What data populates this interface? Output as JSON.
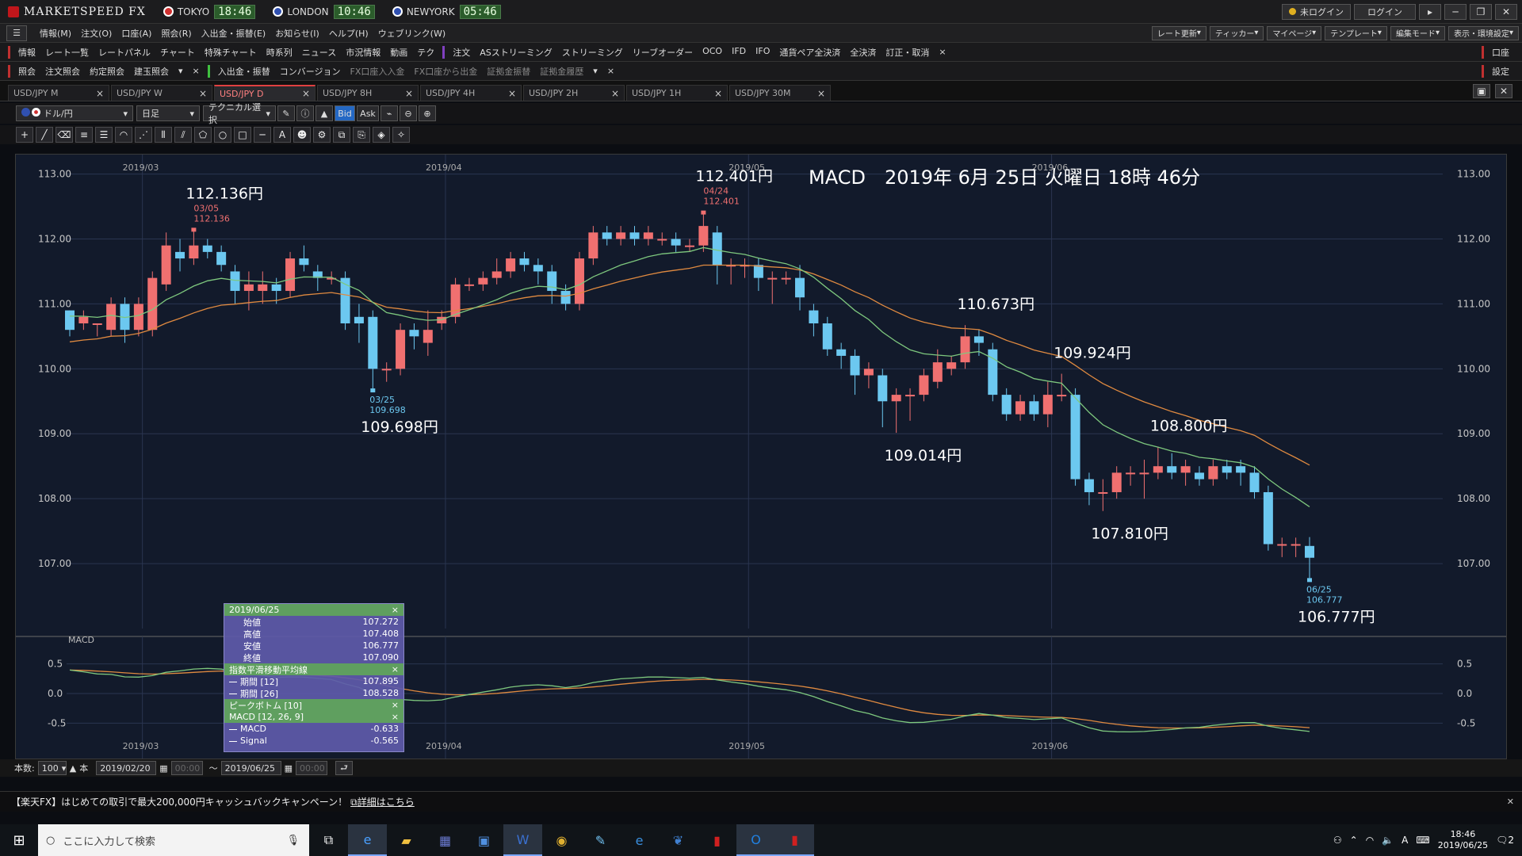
{
  "app": {
    "title": "MARKETSPEED FX"
  },
  "clocks": [
    {
      "city": "TOKYO",
      "time": "18:46",
      "color": "#d03030"
    },
    {
      "city": "LONDON",
      "time": "10:46",
      "color": "#3050b0"
    },
    {
      "city": "NEWYORK",
      "time": "05:46",
      "color": "#3050b0"
    }
  ],
  "titlebar": {
    "login_status": "未ログイン",
    "login_button": "ログイン"
  },
  "menu": [
    "情報(M)",
    "注文(O)",
    "口座(A)",
    "照会(R)",
    "入出金・振替(E)",
    "お知らせ(I)",
    "ヘルプ(H)",
    "ウェブリンク(W)"
  ],
  "menu_right": [
    "レート更新",
    "ティッカー",
    "マイページ",
    "テンプレート",
    "編集モード",
    "表示・環境設定"
  ],
  "toolbar1": {
    "info_label": "情報",
    "info_items": [
      "レート一覧",
      "レートパネル",
      "チャート",
      "特殊チャート",
      "時系列",
      "ニュース",
      "市況情報",
      "動画",
      "テク"
    ],
    "order_label": "注文",
    "order_items": [
      "ASストリーミング",
      "ストリーミング",
      "リーブオーダー",
      "OCO",
      "IFD",
      "IFO",
      "通貨ペア全決済",
      "全決済",
      "訂正・取消"
    ],
    "right": "口座"
  },
  "toolbar2": {
    "inquiry_label": "照会",
    "inquiry_items": [
      "注文照会",
      "約定照会",
      "建玉照会"
    ],
    "deposit_label": "入出金・振替",
    "deposit_items": [
      "コンバージョン",
      "FX口座入入金",
      "FX口座から出金",
      "証拠金振替",
      "証拠金履歴"
    ],
    "right": "設定"
  },
  "tabs": [
    {
      "label": "USD/JPY M",
      "active": false
    },
    {
      "label": "USD/JPY W",
      "active": false
    },
    {
      "label": "USD/JPY D",
      "active": true
    },
    {
      "label": "USD/JPY 8H",
      "active": false
    },
    {
      "label": "USD/JPY 4H",
      "active": false
    },
    {
      "label": "USD/JPY 2H",
      "active": false
    },
    {
      "label": "USD/JPY 1H",
      "active": false
    },
    {
      "label": "USD/JPY 30M",
      "active": false
    }
  ],
  "controls": {
    "pair": "ドル/円",
    "period": "日足",
    "technical": "テクニカル選択",
    "bid": "Bid",
    "ask": "Ask"
  },
  "chart_data": {
    "type": "candlestick",
    "title": "MACD　2019年 6月 25日 火曜日 18時 46分",
    "ylim": [
      106.0,
      113.3
    ],
    "yticks": [
      "113.00",
      "112.00",
      "111.00",
      "110.00",
      "109.00",
      "108.00",
      "107.00"
    ],
    "months": [
      "2019/03",
      "2019/04",
      "2019/05",
      "2019/06"
    ],
    "candles": [
      [
        110.9,
        110.6,
        110.9,
        110.5
      ],
      [
        110.7,
        110.8,
        110.9,
        110.6
      ],
      [
        110.7,
        110.7,
        110.7,
        110.5
      ],
      [
        110.6,
        111.0,
        111.1,
        110.5
      ],
      [
        111.0,
        110.6,
        111.1,
        110.4
      ],
      [
        110.6,
        111.0,
        111.1,
        110.5
      ],
      [
        110.6,
        111.4,
        111.5,
        110.5
      ],
      [
        111.3,
        111.9,
        112.1,
        111.2
      ],
      [
        111.8,
        111.7,
        112.0,
        111.5
      ],
      [
        111.7,
        111.9,
        112.136,
        111.6
      ],
      [
        111.9,
        111.8,
        112.0,
        111.7
      ],
      [
        111.8,
        111.6,
        111.9,
        111.5
      ],
      [
        111.5,
        111.2,
        111.6,
        111.0
      ],
      [
        111.2,
        111.3,
        111.5,
        110.9
      ],
      [
        111.2,
        111.3,
        111.5,
        111.0
      ],
      [
        111.3,
        111.2,
        111.4,
        111.0
      ],
      [
        111.2,
        111.7,
        111.8,
        111.1
      ],
      [
        111.7,
        111.6,
        111.9,
        111.5
      ],
      [
        111.5,
        111.4,
        111.6,
        111.2
      ],
      [
        111.4,
        111.4,
        111.5,
        111.3
      ],
      [
        111.4,
        110.7,
        111.5,
        110.6
      ],
      [
        110.8,
        110.7,
        111.0,
        110.4
      ],
      [
        110.8,
        110.0,
        110.9,
        109.698
      ],
      [
        110.0,
        110.0,
        110.1,
        109.8
      ],
      [
        110.0,
        110.6,
        110.7,
        109.9
      ],
      [
        110.6,
        110.5,
        110.7,
        110.3
      ],
      [
        110.4,
        110.6,
        110.9,
        110.2
      ],
      [
        110.7,
        110.8,
        110.9,
        110.6
      ],
      [
        110.8,
        111.3,
        111.4,
        110.7
      ],
      [
        111.3,
        111.3,
        111.4,
        111.2
      ],
      [
        111.3,
        111.4,
        111.5,
        111.2
      ],
      [
        111.4,
        111.5,
        111.7,
        111.3
      ],
      [
        111.5,
        111.7,
        111.8,
        111.4
      ],
      [
        111.7,
        111.6,
        111.8,
        111.5
      ],
      [
        111.6,
        111.5,
        111.7,
        111.3
      ],
      [
        111.5,
        111.2,
        111.6,
        111.0
      ],
      [
        111.2,
        111.0,
        111.3,
        110.9
      ],
      [
        111.0,
        111.7,
        111.8,
        110.9
      ],
      [
        111.7,
        112.1,
        112.2,
        111.6
      ],
      [
        112.1,
        112.0,
        112.2,
        111.9
      ],
      [
        112.0,
        112.1,
        112.2,
        111.9
      ],
      [
        112.1,
        112.0,
        112.2,
        111.9
      ],
      [
        112.0,
        112.1,
        112.2,
        111.9
      ],
      [
        112.0,
        112.0,
        112.1,
        111.9
      ],
      [
        112.0,
        111.9,
        112.1,
        111.8
      ],
      [
        111.9,
        111.9,
        112.0,
        111.8
      ],
      [
        111.9,
        112.2,
        112.401,
        111.8
      ],
      [
        112.1,
        111.6,
        112.2,
        111.3
      ],
      [
        111.6,
        111.6,
        111.7,
        111.3
      ],
      [
        111.6,
        111.6,
        111.7,
        111.4
      ],
      [
        111.6,
        111.4,
        111.7,
        111.2
      ],
      [
        111.4,
        111.4,
        111.5,
        111.0
      ],
      [
        111.4,
        111.4,
        111.5,
        111.3
      ],
      [
        111.4,
        111.1,
        111.6,
        110.9
      ],
      [
        110.9,
        110.7,
        111.0,
        110.5
      ],
      [
        110.7,
        110.3,
        110.8,
        110.2
      ],
      [
        110.3,
        110.2,
        110.4,
        110.0
      ],
      [
        110.2,
        109.9,
        110.3,
        109.6
      ],
      [
        109.9,
        110.0,
        110.1,
        109.7
      ],
      [
        109.9,
        109.5,
        110.0,
        109.1
      ],
      [
        109.5,
        109.6,
        109.7,
        109.014
      ],
      [
        109.6,
        109.6,
        109.7,
        109.2
      ],
      [
        109.6,
        109.9,
        110.0,
        109.5
      ],
      [
        109.8,
        110.1,
        110.3,
        109.7
      ],
      [
        110.0,
        110.1,
        110.2,
        109.9
      ],
      [
        110.1,
        110.5,
        110.673,
        110.0
      ],
      [
        110.5,
        110.4,
        110.6,
        110.2
      ],
      [
        110.3,
        109.6,
        110.4,
        109.5
      ],
      [
        109.6,
        109.3,
        109.7,
        109.2
      ],
      [
        109.3,
        109.5,
        109.6,
        109.2
      ],
      [
        109.5,
        109.3,
        109.6,
        109.2
      ],
      [
        109.3,
        109.6,
        109.8,
        109.1
      ],
      [
        109.6,
        109.6,
        109.924,
        109.5
      ],
      [
        109.6,
        108.3,
        109.7,
        108.2
      ],
      [
        108.3,
        108.1,
        108.4,
        107.9
      ],
      [
        108.1,
        108.1,
        108.3,
        107.81
      ],
      [
        108.1,
        108.4,
        108.5,
        108.0
      ],
      [
        108.4,
        108.4,
        108.5,
        108.2
      ],
      [
        108.4,
        108.4,
        108.6,
        108.0
      ],
      [
        108.4,
        108.5,
        108.8,
        108.3
      ],
      [
        108.5,
        108.4,
        108.7,
        108.3
      ],
      [
        108.4,
        108.5,
        108.6,
        108.2
      ],
      [
        108.4,
        108.3,
        108.5,
        108.2
      ],
      [
        108.3,
        108.5,
        108.6,
        108.2
      ],
      [
        108.5,
        108.4,
        108.6,
        108.3
      ],
      [
        108.5,
        108.4,
        108.6,
        108.2
      ],
      [
        108.4,
        108.1,
        108.5,
        108.0
      ],
      [
        108.1,
        107.3,
        108.2,
        107.2
      ],
      [
        107.3,
        107.3,
        107.4,
        107.1
      ],
      [
        107.3,
        107.3,
        107.4,
        107.1
      ],
      [
        107.272,
        107.09,
        107.408,
        106.777
      ]
    ],
    "peak_labels": [
      {
        "text": "112.136円",
        "sub_date": "03/05",
        "sub_val": "112.136",
        "type": "high",
        "idx": 9
      },
      {
        "text": "109.698円",
        "sub_date": "03/25",
        "sub_val": "109.698",
        "type": "low",
        "idx": 22
      },
      {
        "text": "112.401円",
        "sub_date": "04/24",
        "sub_val": "112.401",
        "type": "high",
        "idx": 46
      },
      {
        "text": "109.014円",
        "type": "low",
        "idx": 60
      },
      {
        "text": "110.673円",
        "type": "high",
        "idx": 65
      },
      {
        "text": "109.924円",
        "type": "high",
        "idx": 72
      },
      {
        "text": "107.810円",
        "type": "low",
        "idx": 75
      },
      {
        "text": "108.800円",
        "type": "high",
        "idx": 79
      },
      {
        "text": "106.777円",
        "sub_date": "06/25",
        "sub_val": "106.777",
        "type": "low",
        "idx": 90
      }
    ],
    "ema12_color": "#7ec87e",
    "ema26_color": "#e08a40",
    "up_color": "#f07070",
    "down_color": "#6cc8f0",
    "macd": {
      "label": "MACD",
      "ylim": [
        -0.75,
        0.75
      ],
      "yticks": [
        "0.5",
        "0.0",
        "-0.5"
      ],
      "macd_color": "#7ec87e",
      "signal_color": "#e08a40"
    }
  },
  "infobox": {
    "date": "2019/06/25",
    "ohlc": [
      {
        "label": "始値",
        "value": "107.272"
      },
      {
        "label": "高値",
        "value": "107.408"
      },
      {
        "label": "安値",
        "value": "106.777"
      },
      {
        "label": "終値",
        "value": "107.090"
      }
    ],
    "ema_title": "指数平滑移動平均線",
    "ema": [
      {
        "label": "期間 [12]",
        "value": "107.895"
      },
      {
        "label": "期間 [26]",
        "value": "108.528"
      }
    ],
    "peak_title": "ピークボトム [10]",
    "macd_title": "MACD [12, 26, 9]",
    "macd": [
      {
        "label": "MACD",
        "value": "-0.633"
      },
      {
        "label": "Signal",
        "value": "-0.565"
      }
    ]
  },
  "bottom": {
    "count_label": "本数:",
    "count": "100",
    "unit": "本",
    "from": "2019/02/20",
    "from_time": "00:00",
    "tilde": "～",
    "to": "2019/06/25",
    "to_time": "00:00"
  },
  "promo": {
    "text": "【楽天FX】はじめての取引で最大200,000円キャッシュバックキャンペーン！",
    "link": "詳細はこちら"
  },
  "taskbar": {
    "search_placeholder": "ここに入力して検索",
    "time": "18:46",
    "date": "2019/06/25",
    "ime": "A",
    "notif": "2"
  }
}
